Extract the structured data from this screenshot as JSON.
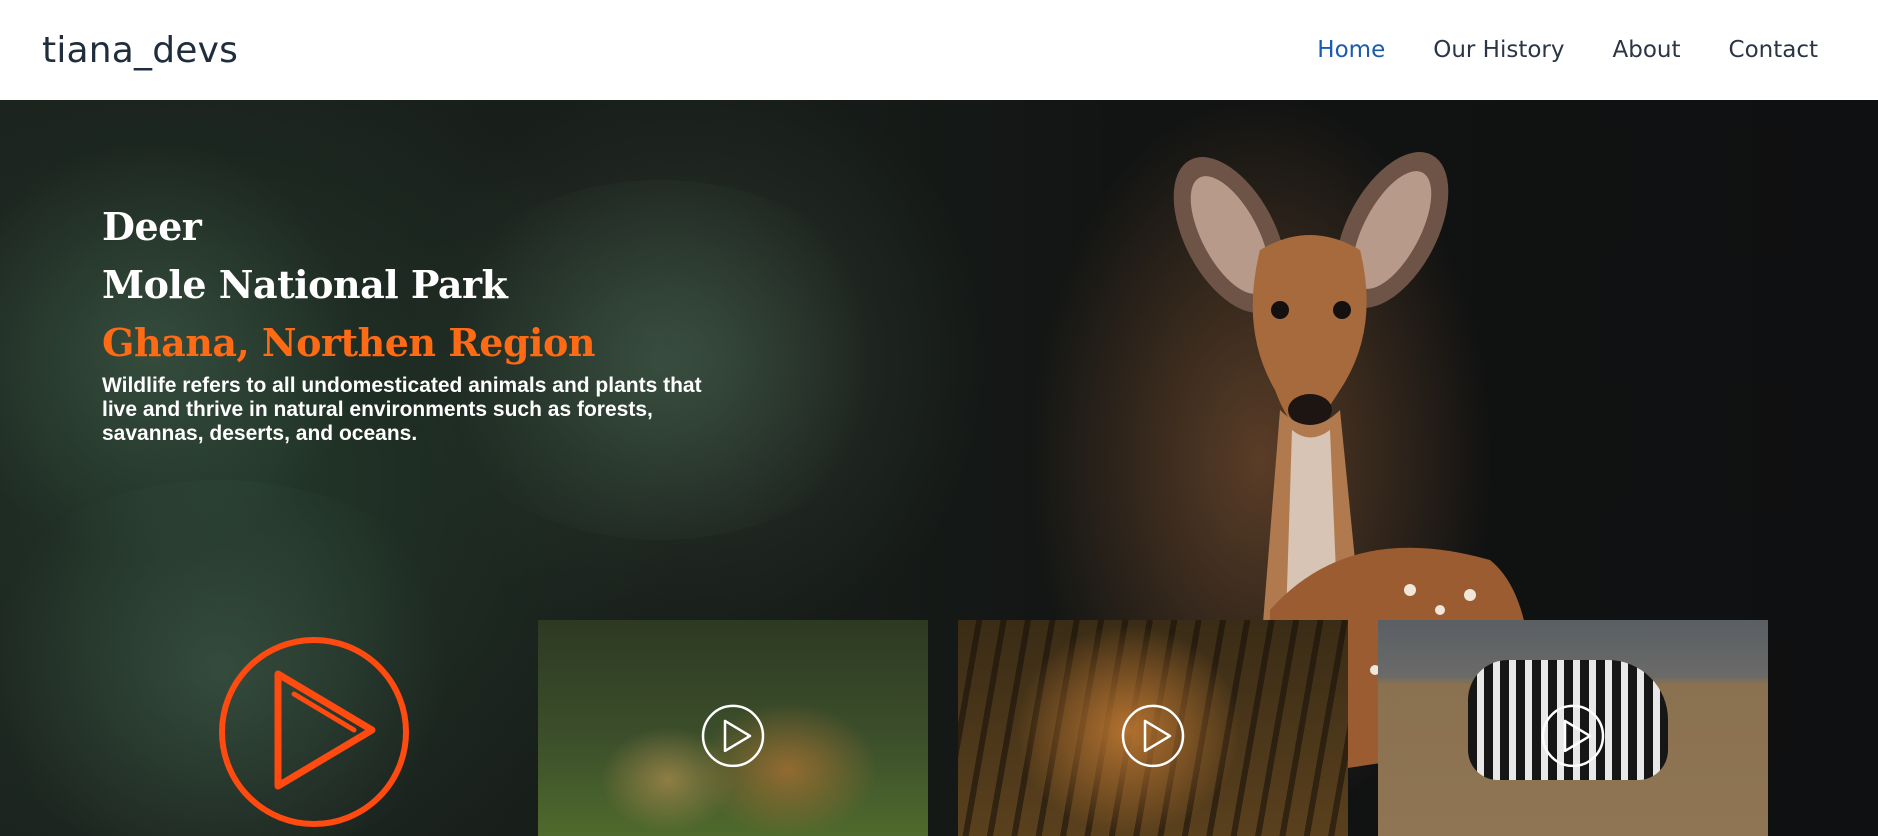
{
  "header": {
    "brand": "tiana_devs",
    "nav": [
      {
        "label": "Home",
        "active": true
      },
      {
        "label": "Our History",
        "active": false
      },
      {
        "label": "About",
        "active": false
      },
      {
        "label": "Contact",
        "active": false
      }
    ]
  },
  "hero": {
    "title_line1": "Deer",
    "title_line2": "Mole National Park",
    "subtitle": "Ghana, Northen Region",
    "description": "Wildlife refers to all undomesticated animals and plants that live and thrive in natural environments such as forests, savannas, deserts, and oceans.",
    "main_play_icon": "play-circle-icon"
  },
  "thumbnails": [
    {
      "animal": "lion",
      "icon": "play-circle-icon"
    },
    {
      "animal": "tiger",
      "icon": "play-circle-icon"
    },
    {
      "animal": "zebra",
      "icon": "play-circle-icon"
    }
  ],
  "colors": {
    "accent": "#ff6a14",
    "play_ring": "#ff4a10",
    "nav_active": "#1a5bb0",
    "nav_text": "#2b3544"
  }
}
